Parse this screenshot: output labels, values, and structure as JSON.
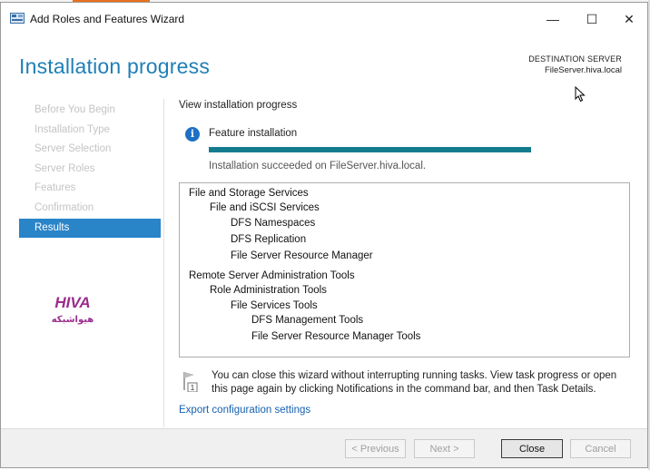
{
  "window": {
    "title": "Add Roles and Features Wizard",
    "minimize_glyph": "—",
    "maximize_glyph": "☐",
    "close_glyph": "✕"
  },
  "header": {
    "title": "Installation progress",
    "destination_label": "DESTINATION SERVER",
    "destination_server": "FileServer.hiva.local"
  },
  "nav": {
    "items": [
      {
        "label": "Before You Begin",
        "active": false
      },
      {
        "label": "Installation Type",
        "active": false
      },
      {
        "label": "Server Selection",
        "active": false
      },
      {
        "label": "Server Roles",
        "active": false
      },
      {
        "label": "Features",
        "active": false
      },
      {
        "label": "Confirmation",
        "active": false
      },
      {
        "label": "Results",
        "active": true
      }
    ]
  },
  "logo": {
    "latin": "HIVA",
    "native": "هیواشبکه"
  },
  "main": {
    "view_progress": "View installation progress",
    "feature_installation": "Feature installation",
    "progress_fraction": 1.0,
    "status_text": "Installation succeeded on FileServer.hiva.local.",
    "results": [
      {
        "label": "File and Storage Services",
        "level": 0
      },
      {
        "label": "File and iSCSI Services",
        "level": 1
      },
      {
        "label": "DFS Namespaces",
        "level": 2
      },
      {
        "label": "DFS Replication",
        "level": 2
      },
      {
        "label": "File Server Resource Manager",
        "level": 2
      },
      {
        "label": "Remote Server Administration Tools",
        "level": 0
      },
      {
        "label": "Role Administration Tools",
        "level": 1
      },
      {
        "label": "File Services Tools",
        "level": 2
      },
      {
        "label": "DFS Management Tools",
        "level": 3
      },
      {
        "label": "File Server Resource Manager Tools",
        "level": 3
      }
    ],
    "note_badge": "1",
    "note_text": "You can close this wizard without interrupting running tasks. View task progress or open this page again by clicking Notifications in the command bar, and then Task Details.",
    "export_link": "Export configuration settings"
  },
  "footer": {
    "previous_label": "< Previous",
    "next_label": "Next >",
    "close_label": "Close",
    "cancel_label": "Cancel"
  },
  "colors": {
    "accent": "#1e7fb6",
    "nav_active": "#2a84c8",
    "progress": "#147b8f",
    "link": "#1560b0"
  }
}
